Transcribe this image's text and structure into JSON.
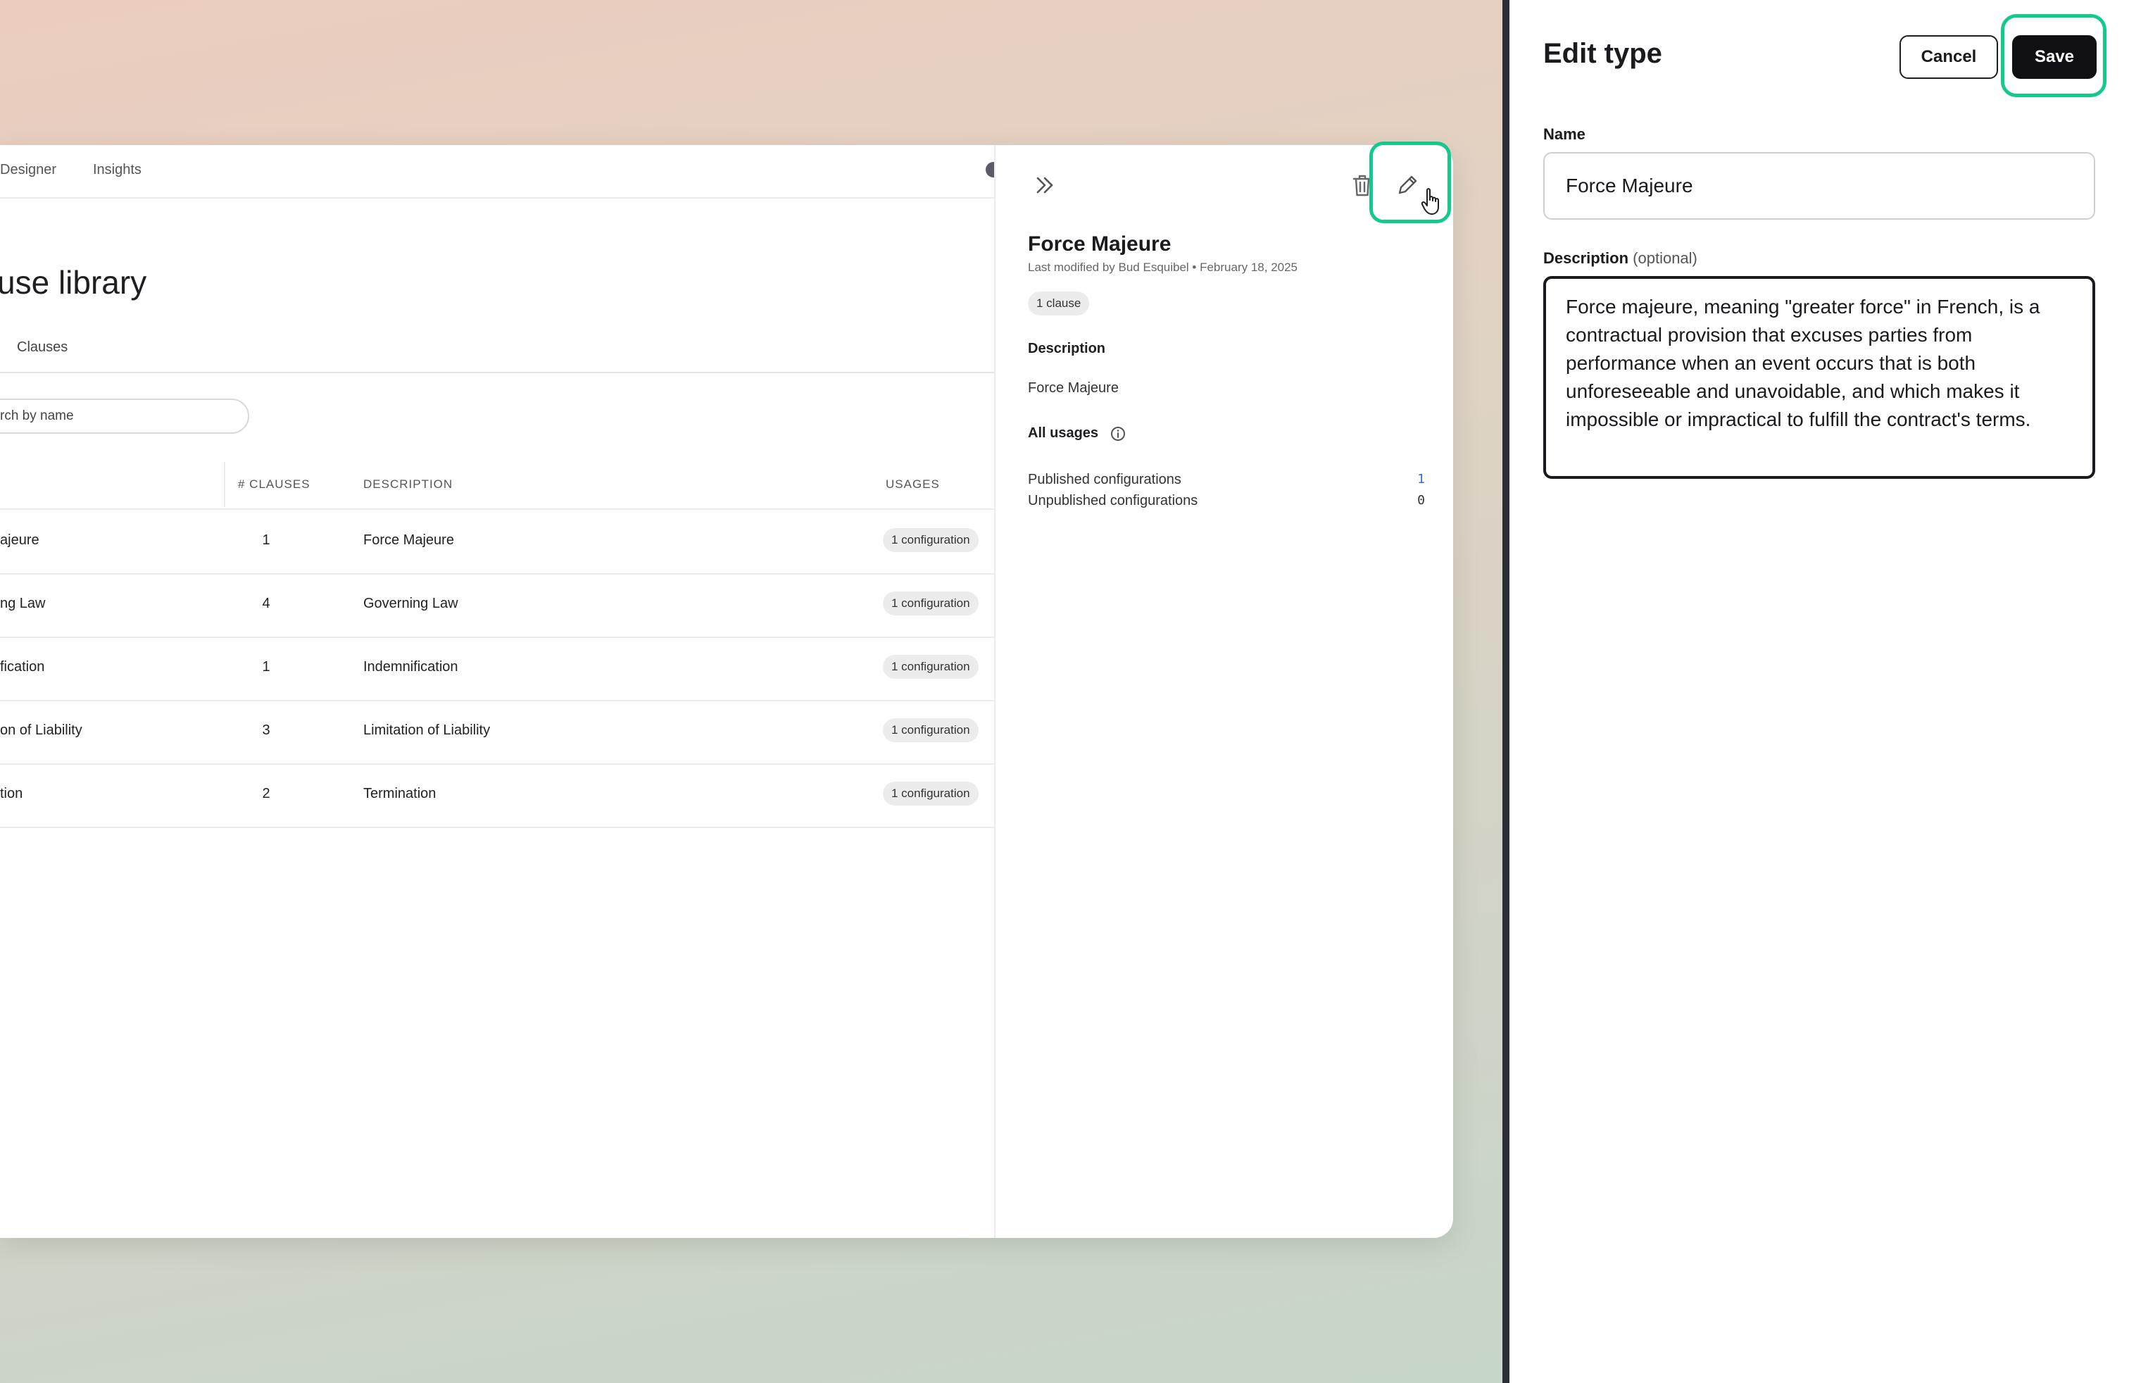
{
  "nav": {
    "tabs": [
      "Designer",
      "Insights"
    ]
  },
  "page": {
    "title": "use library",
    "tab_clauses": "Clauses",
    "search_placeholder": "rch by name"
  },
  "table": {
    "headers": {
      "clauses": "# CLAUSES",
      "description": "DESCRIPTION",
      "usages": "USAGES"
    },
    "rows": [
      {
        "name": "ajeure",
        "count": "1",
        "description": "Force Majeure",
        "usage": "1 configuration"
      },
      {
        "name": "ng Law",
        "count": "4",
        "description": "Governing Law",
        "usage": "1 configuration"
      },
      {
        "name": "fication",
        "count": "1",
        "description": "Indemnification",
        "usage": "1 configuration"
      },
      {
        "name": "on of Liability",
        "count": "3",
        "description": "Limitation of Liability",
        "usage": "1 configuration"
      },
      {
        "name": "tion",
        "count": "2",
        "description": "Termination",
        "usage": "1 configuration"
      }
    ]
  },
  "detail": {
    "title": "Force Majeure",
    "meta": "Last modified by Bud Esquibel • February 18, 2025",
    "badge": "1 clause",
    "description_heading": "Description",
    "description_text": "Force Majeure",
    "usages_heading": "All usages",
    "published_label": "Published configurations",
    "published_count": "1",
    "unpublished_label": "Unpublished configurations",
    "unpublished_count": "0",
    "icons": [
      "collapse-icon",
      "trash-icon",
      "pencil-icon",
      "cursor-icon"
    ]
  },
  "edit": {
    "title": "Edit type",
    "cancel_label": "Cancel",
    "save_label": "Save",
    "name_label": "Name",
    "name_value": "Force Majeure",
    "description_label": "Description",
    "description_optional": "(optional)",
    "description_value": "Force majeure, meaning \"greater force\" in French, is a contractual provision that excuses parties from performance when an event occurs that is both unforeseeable and unavoidable, and which makes it impossible or impractical to fulfill the contract's terms."
  },
  "colors": {
    "accent": "#14c98c",
    "primary_button": "#101014",
    "link": "#2f6fd6"
  }
}
